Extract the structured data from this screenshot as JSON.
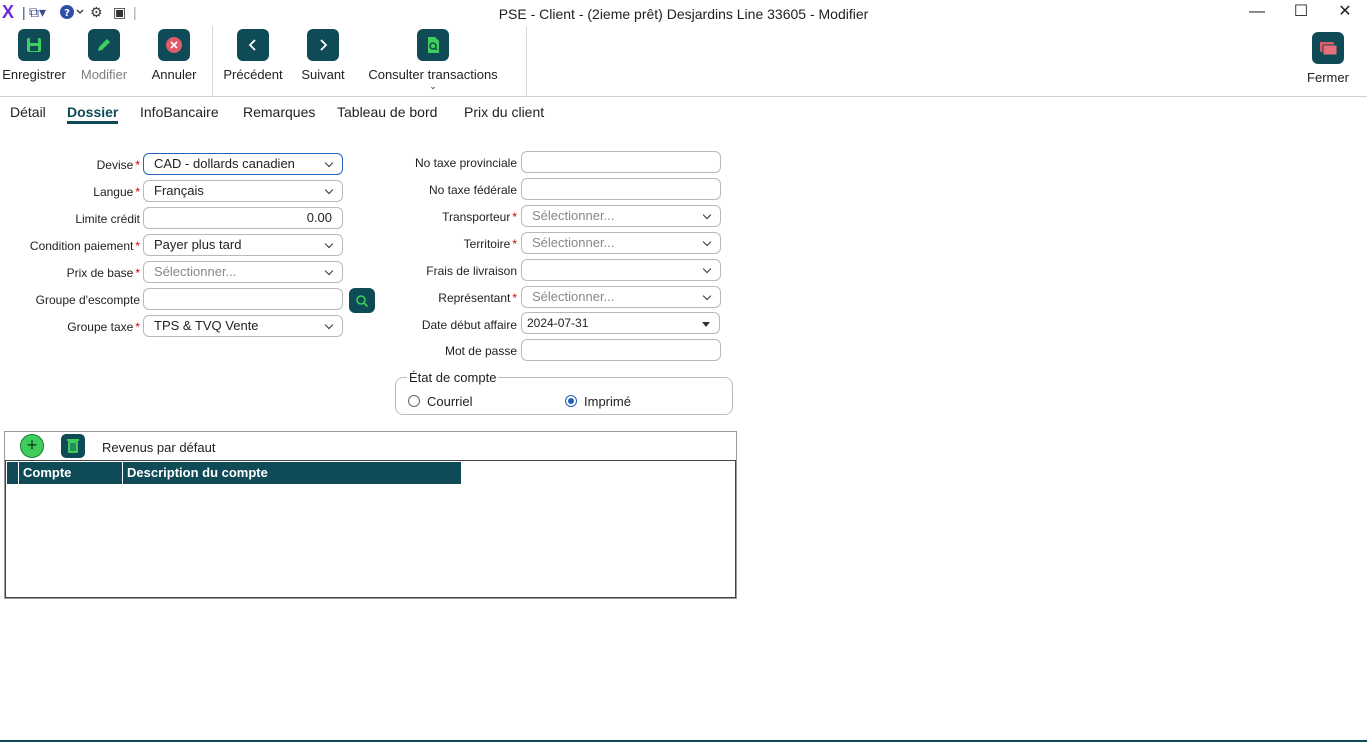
{
  "window": {
    "title": "PSE - Client - (2ieme prêt) Desjardins Line 33605 - Modifier",
    "minimize": "—",
    "maximize": "☐",
    "close": "✕"
  },
  "quick_access": {
    "logo": "X",
    "icons": [
      "logo-icon",
      "windows-icon",
      "help-icon",
      "settings-icon",
      "export-icon"
    ]
  },
  "ribbon": {
    "save": "Enregistrer",
    "edit": "Modifier",
    "cancel": "Annuler",
    "previous": "Précédent",
    "next": "Suivant",
    "transactions": "Consulter transactions",
    "close": "Fermer"
  },
  "tabs": [
    "Détail",
    "Dossier",
    "InfoBancaire",
    "Remarques",
    "Tableau de bord",
    "Prix du client"
  ],
  "active_tab": "Dossier",
  "form_left": {
    "devise": {
      "label": "Devise",
      "value": "CAD - dollards canadien"
    },
    "langue": {
      "label": "Langue",
      "value": "Français"
    },
    "limite_credit": {
      "label": "Limite crédit",
      "value": "0.00"
    },
    "condition_paiement": {
      "label": "Condition paiement",
      "value": "Payer plus tard"
    },
    "prix_de_base": {
      "label": "Prix de base",
      "placeholder": "Sélectionner..."
    },
    "groupe_escompte": {
      "label": "Groupe d'escompte",
      "value": ""
    },
    "groupe_taxe": {
      "label": "Groupe taxe",
      "value": "TPS & TVQ Vente"
    }
  },
  "form_right": {
    "no_taxe_provinciale": {
      "label": "No taxe provinciale",
      "value": ""
    },
    "no_taxe_federale": {
      "label": "No taxe fédérale",
      "value": ""
    },
    "transporteur": {
      "label": "Transporteur",
      "placeholder": "Sélectionner..."
    },
    "territoire": {
      "label": "Territoire",
      "placeholder": "Sélectionner..."
    },
    "frais_livraison": {
      "label": "Frais de livraison",
      "value": ""
    },
    "representant": {
      "label": "Représentant",
      "placeholder": "Sélectionner..."
    },
    "date_debut": {
      "label": "Date début affaire",
      "value": "2024-07-31"
    },
    "mot_de_passe": {
      "label": "Mot de passe",
      "value": ""
    }
  },
  "etat_compte": {
    "legend": "État de compte",
    "options": [
      "Courriel",
      "Imprimé"
    ],
    "selected": "Imprimé"
  },
  "revenus": {
    "title": "Revenus par défaut",
    "columns": [
      "Compte",
      "Description du compte"
    ],
    "rows": []
  },
  "colors": {
    "accent": "#0f4a57",
    "required": "#cc0000",
    "add_green": "#3fce5b",
    "cancel_red": "#e05a6a",
    "logo_purple": "#6a2bd6"
  }
}
